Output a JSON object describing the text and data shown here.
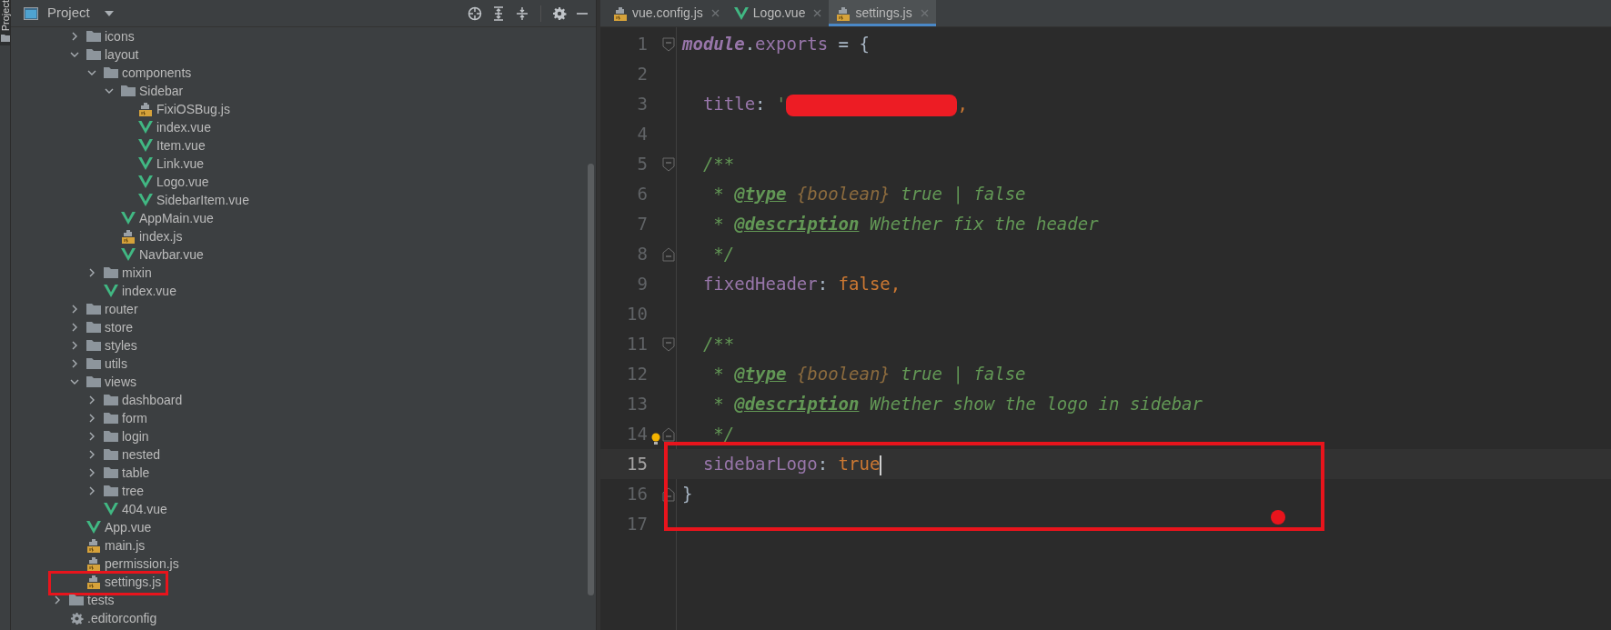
{
  "side_strip": {
    "label": "Project"
  },
  "project_panel": {
    "title": "Project"
  },
  "tree": {
    "scrolled_items": [
      {
        "name": "icons",
        "kind": "folder",
        "expanded": false
      },
      {
        "name": "layout",
        "kind": "folder",
        "expanded": true,
        "children": [
          {
            "name": "components",
            "kind": "folder",
            "expanded": true,
            "children": [
              {
                "name": "Sidebar",
                "kind": "folder",
                "expanded": true,
                "children": [
                  {
                    "name": "FixiOSBug.js",
                    "kind": "js"
                  },
                  {
                    "name": "index.vue",
                    "kind": "vue"
                  },
                  {
                    "name": "Item.vue",
                    "kind": "vue"
                  },
                  {
                    "name": "Link.vue",
                    "kind": "vue"
                  },
                  {
                    "name": "Logo.vue",
                    "kind": "vue"
                  },
                  {
                    "name": "SidebarItem.vue",
                    "kind": "vue"
                  }
                ]
              },
              {
                "name": "AppMain.vue",
                "kind": "vue"
              },
              {
                "name": "index.js",
                "kind": "js"
              },
              {
                "name": "Navbar.vue",
                "kind": "vue"
              }
            ]
          },
          {
            "name": "mixin",
            "kind": "folder",
            "expanded": false
          },
          {
            "name": "index.vue",
            "kind": "vue"
          }
        ]
      },
      {
        "name": "router",
        "kind": "folder",
        "expanded": false
      },
      {
        "name": "store",
        "kind": "folder",
        "expanded": false
      },
      {
        "name": "styles",
        "kind": "folder",
        "expanded": false
      },
      {
        "name": "utils",
        "kind": "folder",
        "expanded": false
      },
      {
        "name": "views",
        "kind": "folder",
        "expanded": true,
        "children": [
          {
            "name": "dashboard",
            "kind": "folder",
            "expanded": false
          },
          {
            "name": "form",
            "kind": "folder",
            "expanded": false
          },
          {
            "name": "login",
            "kind": "folder",
            "expanded": false
          },
          {
            "name": "nested",
            "kind": "folder",
            "expanded": false
          },
          {
            "name": "table",
            "kind": "folder",
            "expanded": false
          },
          {
            "name": "tree",
            "kind": "folder",
            "expanded": false
          },
          {
            "name": "404.vue",
            "kind": "vue"
          }
        ]
      },
      {
        "name": "App.vue",
        "kind": "vue"
      },
      {
        "name": "main.js",
        "kind": "js"
      },
      {
        "name": "permission.js",
        "kind": "js"
      },
      {
        "name": "settings.js",
        "kind": "js",
        "annotated": true
      }
    ],
    "root_items": [
      {
        "name": "tests",
        "kind": "folder",
        "expanded": false
      },
      {
        "name": ".editorconfig",
        "kind": "config"
      }
    ]
  },
  "tabs": [
    {
      "label": "vue.config.js",
      "kind": "js",
      "selected": false
    },
    {
      "label": "Logo.vue",
      "kind": "vue",
      "selected": false
    },
    {
      "label": "settings.js",
      "kind": "js",
      "selected": true
    }
  ],
  "editor": {
    "lines": [
      {
        "number": "1",
        "current": false,
        "fold_start": true,
        "tokens": [
          {
            "text": "module",
            "kind": "keyword"
          },
          {
            "text": ".",
            "kind": "punct"
          },
          {
            "text": "exports",
            "kind": "prop"
          },
          {
            "text": " = {",
            "kind": "punct"
          }
        ]
      },
      {
        "number": "2",
        "current": false
      },
      {
        "number": "3",
        "current": false,
        "tokens": [
          {
            "text": "  title",
            "kind": "prop"
          },
          {
            "text": ": ",
            "kind": "punct"
          },
          {
            "text": "'",
            "kind": "string"
          },
          {
            "kind": "redacted"
          },
          {
            "text": ",",
            "kind": "bool"
          }
        ]
      },
      {
        "number": "4",
        "current": false
      },
      {
        "number": "5",
        "current": false,
        "fold_start": true,
        "tokens": [
          {
            "text": "  /**",
            "kind": "comment"
          }
        ]
      },
      {
        "number": "6",
        "current": false,
        "tokens": [
          {
            "text": "   * ",
            "kind": "comment"
          },
          {
            "text": "@type",
            "kind": "tag"
          },
          {
            "text": " {boolean}",
            "kind": "type"
          },
          {
            "text": " true | false",
            "kind": "comment"
          }
        ]
      },
      {
        "number": "7",
        "current": false,
        "tokens": [
          {
            "text": "   * ",
            "kind": "comment"
          },
          {
            "text": "@description",
            "kind": "tag"
          },
          {
            "text": " Whether fix the header",
            "kind": "comment"
          }
        ]
      },
      {
        "number": "8",
        "current": false,
        "fold_end": true,
        "tokens": [
          {
            "text": "   */",
            "kind": "comment"
          }
        ]
      },
      {
        "number": "9",
        "current": false,
        "tokens": [
          {
            "text": "  fixedHeader",
            "kind": "prop"
          },
          {
            "text": ": ",
            "kind": "punct"
          },
          {
            "text": "false,",
            "kind": "bool"
          }
        ]
      },
      {
        "number": "10",
        "current": false
      },
      {
        "number": "11",
        "current": false,
        "fold_start": true,
        "tokens": [
          {
            "text": "  /**",
            "kind": "comment"
          }
        ]
      },
      {
        "number": "12",
        "current": false,
        "tokens": [
          {
            "text": "   * ",
            "kind": "comment"
          },
          {
            "text": "@type",
            "kind": "tag"
          },
          {
            "text": " {boolean}",
            "kind": "type"
          },
          {
            "text": " true | false",
            "kind": "comment"
          }
        ]
      },
      {
        "number": "13",
        "current": false,
        "tokens": [
          {
            "text": "   * ",
            "kind": "comment"
          },
          {
            "text": "@description",
            "kind": "tag"
          },
          {
            "text": " Whether show the logo in sidebar",
            "kind": "comment"
          }
        ]
      },
      {
        "number": "14",
        "current": false,
        "fold_end": true,
        "bulb": true,
        "tokens": [
          {
            "text": "   */",
            "kind": "comment"
          }
        ]
      },
      {
        "number": "15",
        "current": true,
        "tokens": [
          {
            "text": "  sidebarLogo",
            "kind": "prop"
          },
          {
            "text": ": ",
            "kind": "punct"
          },
          {
            "text": "true",
            "kind": "bool"
          }
        ]
      },
      {
        "number": "16",
        "current": false,
        "fold_end": true,
        "tokens": [
          {
            "text": "}",
            "kind": "punct"
          }
        ]
      },
      {
        "number": "17",
        "current": false
      }
    ]
  }
}
